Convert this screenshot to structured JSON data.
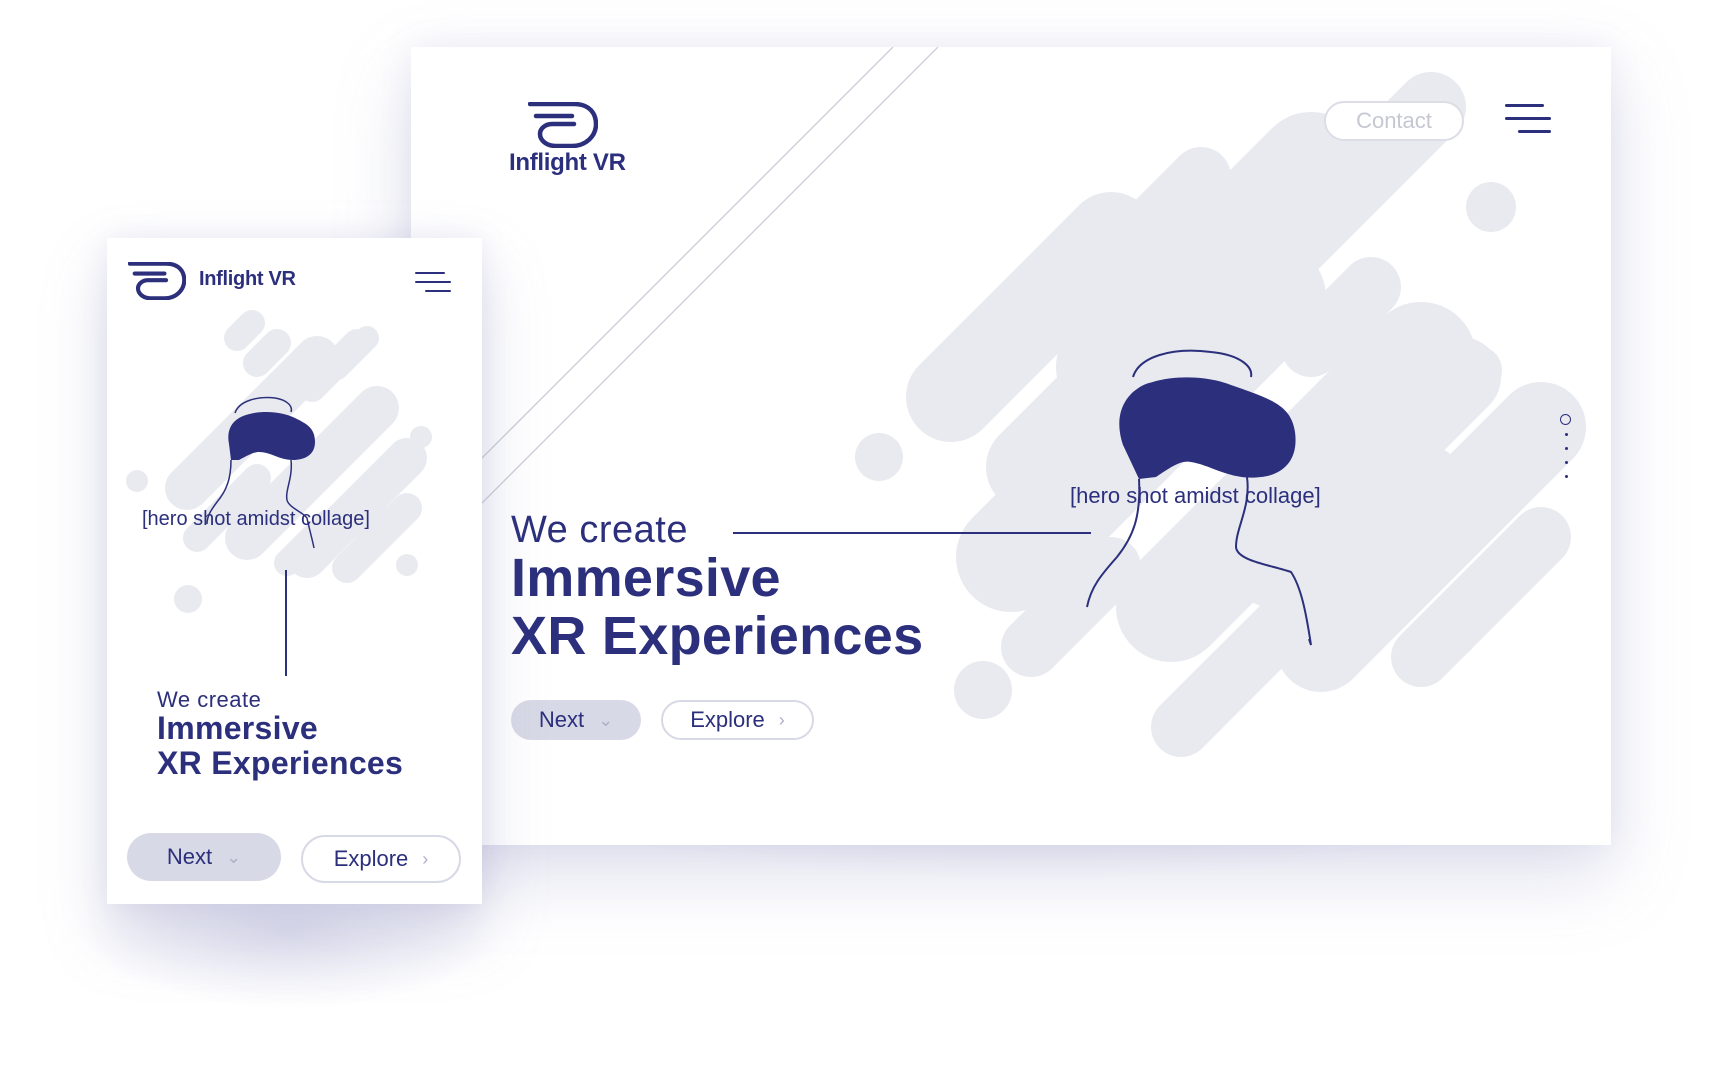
{
  "brand": {
    "name": "Inflight VR"
  },
  "desktop": {
    "contact_label": "Contact",
    "hero": {
      "intro": "We create",
      "headline_line1": "Immersive",
      "headline_line2": "XR Experiences",
      "image_caption": "[hero shot amidst collage]"
    },
    "buttons": {
      "next_label": "Next",
      "explore_label": "Explore"
    },
    "pager": {
      "total": 5,
      "active_index": 0
    }
  },
  "mobile": {
    "hero": {
      "intro": "We create",
      "headline_line1": "Immersive",
      "headline_line2": "XR Experiences",
      "image_caption": "[hero shot amidst collage]"
    },
    "buttons": {
      "next_label": "Next",
      "explore_label": "Explore"
    }
  },
  "colors": {
    "brand_navy": "#2b2f7c",
    "collage_gray": "#e9eaf0",
    "button_gray": "#d8d9e6",
    "outline_gray": "#dcdde6"
  },
  "icons": [
    "logo-mark-icon",
    "hamburger-menu-icon",
    "chevron-down-icon",
    "chevron-right-icon",
    "vr-headset-illustration"
  ]
}
